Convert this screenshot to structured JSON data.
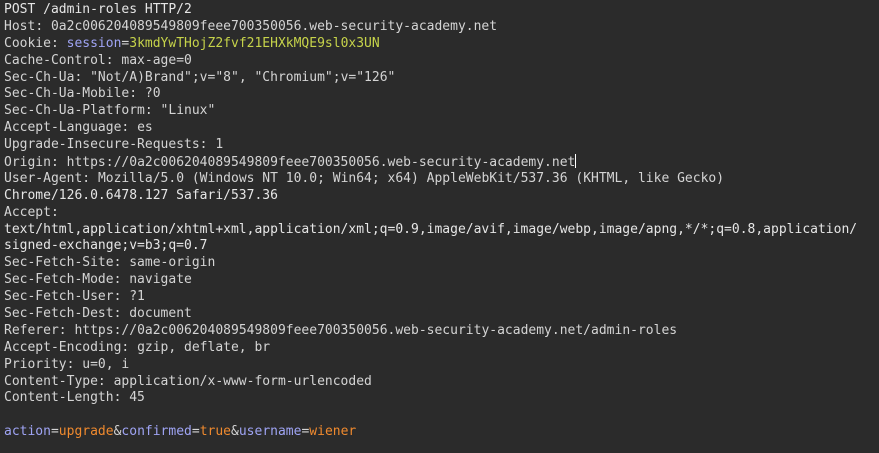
{
  "request_line": "POST /admin-roles HTTP/2",
  "headers": [
    {
      "name": "Host",
      "value": "0a2c006204089549809feee700350056.web-security-academy.net"
    },
    {
      "name": "Cookie",
      "cookie_name": "session",
      "cookie_value": "3kmdYwTHojZ2fvf21EHXkMQE9sl0x3UN"
    },
    {
      "name": "Cache-Control",
      "value": "max-age=0"
    },
    {
      "name": "Sec-Ch-Ua",
      "value": "\"Not/A)Brand\";v=\"8\", \"Chromium\";v=\"126\""
    },
    {
      "name": "Sec-Ch-Ua-Mobile",
      "value": "?0"
    },
    {
      "name": "Sec-Ch-Ua-Platform",
      "value": "\"Linux\""
    },
    {
      "name": "Accept-Language",
      "value": "es"
    },
    {
      "name": "Upgrade-Insecure-Requests",
      "value": "1"
    },
    {
      "name": "Origin",
      "value": "https://0a2c006204089549809feee700350056.web-security-academy.net"
    },
    {
      "name": "User-Agent",
      "value": "Mozilla/5.0 (Windows NT 10.0; Win64; x64) AppleWebKit/537.36 (KHTML, like Gecko)",
      "continuation": "Chrome/126.0.6478.127 Safari/537.36"
    },
    {
      "name": "Accept",
      "value": "",
      "continuation": "text/html,application/xhtml+xml,application/xml;q=0.9,image/avif,image/webp,image/apng,*/*;q=0.8,application/",
      "continuation2": "signed-exchange;v=b3;q=0.7"
    },
    {
      "name": "Sec-Fetch-Site",
      "value": "same-origin"
    },
    {
      "name": "Sec-Fetch-Mode",
      "value": "navigate"
    },
    {
      "name": "Sec-Fetch-User",
      "value": "?1"
    },
    {
      "name": "Sec-Fetch-Dest",
      "value": "document"
    },
    {
      "name": "Referer",
      "value": "https://0a2c006204089549809feee700350056.web-security-academy.net/admin-roles"
    },
    {
      "name": "Accept-Encoding",
      "value": "gzip, deflate, br"
    },
    {
      "name": "Priority",
      "value": "u=0, i"
    },
    {
      "name": "Content-Type",
      "value": "application/x-www-form-urlencoded"
    },
    {
      "name": "Content-Length",
      "value": "45"
    }
  ],
  "body": {
    "params": [
      {
        "name": "action",
        "value": "upgrade"
      },
      {
        "name": "confirmed",
        "value": "true"
      },
      {
        "name": "username",
        "value": "wiener"
      }
    ]
  },
  "colors": {
    "background": "#2b2b2b",
    "text": "#d4d4d4",
    "cookie_name": "#9fa4f4",
    "cookie_value": "#c6d34a",
    "param_name": "#9fa4f4",
    "param_value": "#f08a2e"
  }
}
